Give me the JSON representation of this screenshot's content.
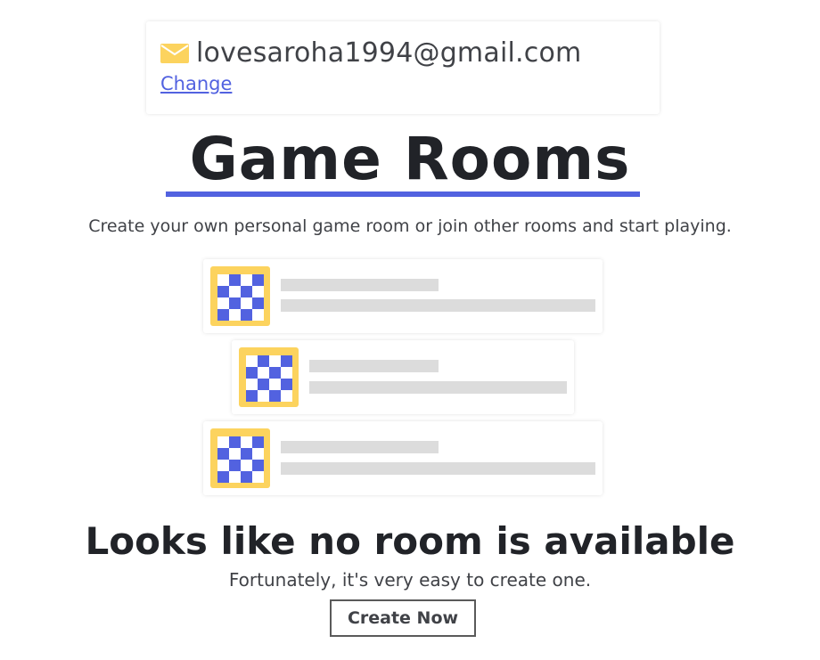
{
  "account": {
    "email": "lovesaroha1994@gmail.com",
    "change_label": "Change",
    "icon": "envelope-icon"
  },
  "header": {
    "title": "Game Rooms",
    "subtitle": "Create your own personal game room or join other rooms and start playing."
  },
  "placeholder_rooms": [
    {
      "icon": "checkerboard-icon"
    },
    {
      "icon": "checkerboard-icon"
    },
    {
      "icon": "checkerboard-icon"
    }
  ],
  "empty_state": {
    "headline": "Looks like no room is available",
    "tagline": "Fortunately, it's very easy to create one.",
    "button_label": "Create Now"
  },
  "colors": {
    "accent": "#5262e0",
    "icon_yellow": "#fcd35e",
    "text_dark": "#212328",
    "text_muted": "#404247",
    "skeleton": "#dcdcdc"
  }
}
